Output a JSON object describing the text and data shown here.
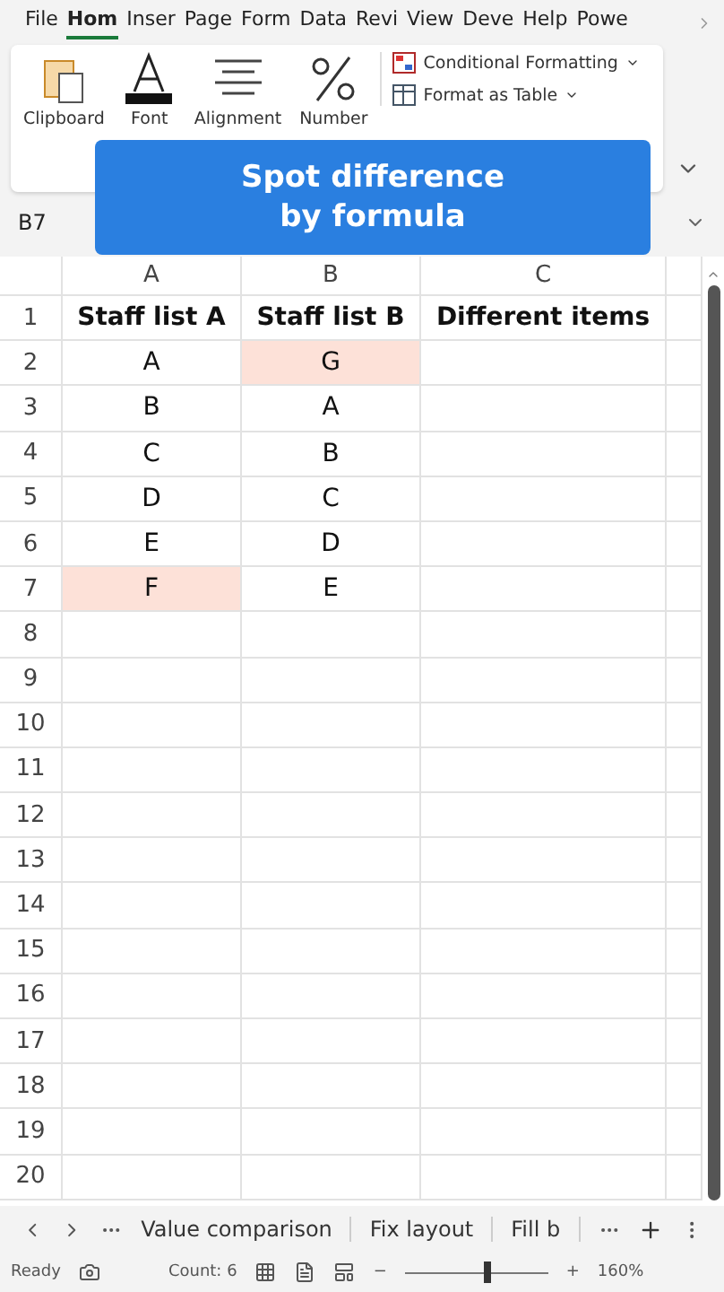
{
  "ribbon_tabs": [
    {
      "label": "File",
      "selected": false
    },
    {
      "label": "Hom",
      "selected": true
    },
    {
      "label": "Inser",
      "selected": false
    },
    {
      "label": "Page",
      "selected": false
    },
    {
      "label": "Form",
      "selected": false
    },
    {
      "label": "Data",
      "selected": false
    },
    {
      "label": "Revi",
      "selected": false
    },
    {
      "label": "View",
      "selected": false
    },
    {
      "label": "Deve",
      "selected": false
    },
    {
      "label": "Help",
      "selected": false
    },
    {
      "label": "Powe",
      "selected": false
    }
  ],
  "ribbon_groups": [
    {
      "kind": "clipboard",
      "label": "Clipboard"
    },
    {
      "kind": "font",
      "label": "Font"
    },
    {
      "kind": "alignment",
      "label": "Alignment"
    },
    {
      "kind": "number",
      "label": "Number"
    }
  ],
  "styles_commands": [
    {
      "kind": "conditional",
      "label": "Conditional Formatting"
    },
    {
      "kind": "table",
      "label": "Format as Table"
    }
  ],
  "banner": {
    "lines": [
      "Spot difference",
      "by formula"
    ]
  },
  "name_box": {
    "value": "B7"
  },
  "columns": [
    "A",
    "B",
    "C"
  ],
  "rows": [
    {
      "number": "1",
      "kind": "header",
      "cells": [
        {
          "text": "Staff list A",
          "highlighted": false
        },
        {
          "text": "Staff list B",
          "highlighted": false
        },
        {
          "text": "Different items",
          "highlighted": false
        }
      ]
    },
    {
      "number": "2",
      "cells": [
        {
          "text": "A",
          "highlighted": false
        },
        {
          "text": "G",
          "highlighted": true
        }
      ]
    },
    {
      "number": "3",
      "cells": [
        {
          "text": "B",
          "highlighted": false
        },
        {
          "text": "A",
          "highlighted": false
        }
      ]
    },
    {
      "number": "4",
      "cells": [
        {
          "text": "C",
          "highlighted": false
        },
        {
          "text": "B",
          "highlighted": false
        }
      ]
    },
    {
      "number": "5",
      "cells": [
        {
          "text": "D",
          "highlighted": false
        },
        {
          "text": "C",
          "highlighted": false
        }
      ]
    },
    {
      "number": "6",
      "cells": [
        {
          "text": "E",
          "highlighted": false
        },
        {
          "text": "D",
          "highlighted": false
        }
      ]
    },
    {
      "number": "7",
      "cells": [
        {
          "text": "F",
          "highlighted": true
        },
        {
          "text": "E",
          "highlighted": false
        }
      ]
    },
    {
      "number": "8",
      "cells": []
    },
    {
      "number": "9",
      "cells": []
    },
    {
      "number": "10",
      "cells": []
    },
    {
      "number": "11",
      "cells": []
    },
    {
      "number": "12",
      "cells": []
    },
    {
      "number": "13",
      "cells": []
    },
    {
      "number": "14",
      "cells": []
    },
    {
      "number": "15",
      "cells": []
    },
    {
      "number": "16",
      "cells": []
    },
    {
      "number": "17",
      "cells": []
    },
    {
      "number": "18",
      "cells": []
    },
    {
      "number": "19",
      "cells": []
    },
    {
      "number": "20",
      "cells": []
    }
  ],
  "sheet_tabs": [
    {
      "label": "Value comparison",
      "selected": false
    },
    {
      "label": "Fix layout",
      "selected": false
    },
    {
      "label": "Fill b",
      "selected": false
    }
  ],
  "status_bar": {
    "status": "Ready",
    "count": "Count: 6",
    "zoom_out": "−",
    "zoom_slider": {
      "level": 0.55
    },
    "zoom_in": "+",
    "zoom": "160%"
  }
}
